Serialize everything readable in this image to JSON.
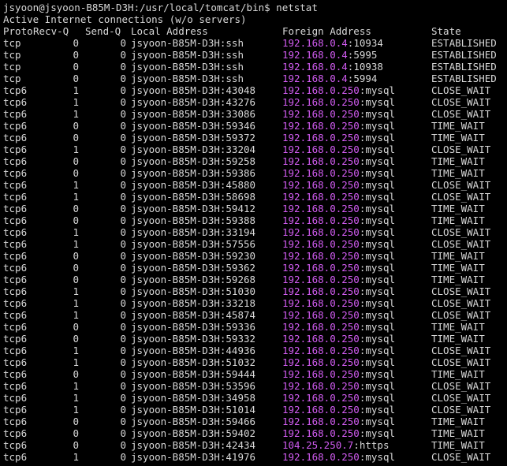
{
  "terminal": {
    "prompt": "jsyoon@jsyoon-B85M-D3H:/usr/local/tomcat/bin$ netstat",
    "title_line": "Active Internet connections (w/o servers)",
    "colors": {
      "background": "#000000",
      "text": "#d8d8d8",
      "ip_highlight": "#d25cf2"
    },
    "headers": {
      "proto": "Proto",
      "recvq": "Recv-Q",
      "sendq": "Send-Q",
      "local": "Local Address",
      "foreign": "Foreign Address",
      "state": "State"
    },
    "rows": [
      {
        "proto": "tcp",
        "recvq": "0",
        "sendq": "0",
        "local": "jsyoon-B85M-D3H:ssh",
        "ip": "192.168.0.4",
        "port": ":10934",
        "state": "ESTABLISHED"
      },
      {
        "proto": "tcp",
        "recvq": "0",
        "sendq": "0",
        "local": "jsyoon-B85M-D3H:ssh",
        "ip": "192.168.0.4",
        "port": ":5995",
        "state": "ESTABLISHED"
      },
      {
        "proto": "tcp",
        "recvq": "0",
        "sendq": "0",
        "local": "jsyoon-B85M-D3H:ssh",
        "ip": "192.168.0.4",
        "port": ":10938",
        "state": "ESTABLISHED"
      },
      {
        "proto": "tcp",
        "recvq": "0",
        "sendq": "0",
        "local": "jsyoon-B85M-D3H:ssh",
        "ip": "192.168.0.4",
        "port": ":5994",
        "state": "ESTABLISHED"
      },
      {
        "proto": "tcp6",
        "recvq": "1",
        "sendq": "0",
        "local": "jsyoon-B85M-D3H:43048",
        "ip": "192.168.0.250",
        "port": ":mysql",
        "state": "CLOSE_WAIT"
      },
      {
        "proto": "tcp6",
        "recvq": "1",
        "sendq": "0",
        "local": "jsyoon-B85M-D3H:43276",
        "ip": "192.168.0.250",
        "port": ":mysql",
        "state": "CLOSE_WAIT"
      },
      {
        "proto": "tcp6",
        "recvq": "1",
        "sendq": "0",
        "local": "jsyoon-B85M-D3H:33086",
        "ip": "192.168.0.250",
        "port": ":mysql",
        "state": "CLOSE_WAIT"
      },
      {
        "proto": "tcp6",
        "recvq": "0",
        "sendq": "0",
        "local": "jsyoon-B85M-D3H:59346",
        "ip": "192.168.0.250",
        "port": ":mysql",
        "state": "TIME_WAIT"
      },
      {
        "proto": "tcp6",
        "recvq": "0",
        "sendq": "0",
        "local": "jsyoon-B85M-D3H:59372",
        "ip": "192.168.0.250",
        "port": ":mysql",
        "state": "TIME_WAIT"
      },
      {
        "proto": "tcp6",
        "recvq": "1",
        "sendq": "0",
        "local": "jsyoon-B85M-D3H:33204",
        "ip": "192.168.0.250",
        "port": ":mysql",
        "state": "CLOSE_WAIT"
      },
      {
        "proto": "tcp6",
        "recvq": "0",
        "sendq": "0",
        "local": "jsyoon-B85M-D3H:59258",
        "ip": "192.168.0.250",
        "port": ":mysql",
        "state": "TIME_WAIT"
      },
      {
        "proto": "tcp6",
        "recvq": "0",
        "sendq": "0",
        "local": "jsyoon-B85M-D3H:59386",
        "ip": "192.168.0.250",
        "port": ":mysql",
        "state": "TIME_WAIT"
      },
      {
        "proto": "tcp6",
        "recvq": "1",
        "sendq": "0",
        "local": "jsyoon-B85M-D3H:45880",
        "ip": "192.168.0.250",
        "port": ":mysql",
        "state": "CLOSE_WAIT"
      },
      {
        "proto": "tcp6",
        "recvq": "1",
        "sendq": "0",
        "local": "jsyoon-B85M-D3H:58698",
        "ip": "192.168.0.250",
        "port": ":mysql",
        "state": "CLOSE_WAIT"
      },
      {
        "proto": "tcp6",
        "recvq": "0",
        "sendq": "0",
        "local": "jsyoon-B85M-D3H:59412",
        "ip": "192.168.0.250",
        "port": ":mysql",
        "state": "TIME_WAIT"
      },
      {
        "proto": "tcp6",
        "recvq": "0",
        "sendq": "0",
        "local": "jsyoon-B85M-D3H:59388",
        "ip": "192.168.0.250",
        "port": ":mysql",
        "state": "TIME_WAIT"
      },
      {
        "proto": "tcp6",
        "recvq": "1",
        "sendq": "0",
        "local": "jsyoon-B85M-D3H:33194",
        "ip": "192.168.0.250",
        "port": ":mysql",
        "state": "CLOSE_WAIT"
      },
      {
        "proto": "tcp6",
        "recvq": "1",
        "sendq": "0",
        "local": "jsyoon-B85M-D3H:57556",
        "ip": "192.168.0.250",
        "port": ":mysql",
        "state": "CLOSE_WAIT"
      },
      {
        "proto": "tcp6",
        "recvq": "0",
        "sendq": "0",
        "local": "jsyoon-B85M-D3H:59230",
        "ip": "192.168.0.250",
        "port": ":mysql",
        "state": "TIME_WAIT"
      },
      {
        "proto": "tcp6",
        "recvq": "0",
        "sendq": "0",
        "local": "jsyoon-B85M-D3H:59362",
        "ip": "192.168.0.250",
        "port": ":mysql",
        "state": "TIME_WAIT"
      },
      {
        "proto": "tcp6",
        "recvq": "0",
        "sendq": "0",
        "local": "jsyoon-B85M-D3H:59268",
        "ip": "192.168.0.250",
        "port": ":mysql",
        "state": "TIME_WAIT"
      },
      {
        "proto": "tcp6",
        "recvq": "1",
        "sendq": "0",
        "local": "jsyoon-B85M-D3H:51030",
        "ip": "192.168.0.250",
        "port": ":mysql",
        "state": "CLOSE_WAIT"
      },
      {
        "proto": "tcp6",
        "recvq": "1",
        "sendq": "0",
        "local": "jsyoon-B85M-D3H:33218",
        "ip": "192.168.0.250",
        "port": ":mysql",
        "state": "CLOSE_WAIT"
      },
      {
        "proto": "tcp6",
        "recvq": "1",
        "sendq": "0",
        "local": "jsyoon-B85M-D3H:45874",
        "ip": "192.168.0.250",
        "port": ":mysql",
        "state": "CLOSE_WAIT"
      },
      {
        "proto": "tcp6",
        "recvq": "0",
        "sendq": "0",
        "local": "jsyoon-B85M-D3H:59336",
        "ip": "192.168.0.250",
        "port": ":mysql",
        "state": "TIME_WAIT"
      },
      {
        "proto": "tcp6",
        "recvq": "0",
        "sendq": "0",
        "local": "jsyoon-B85M-D3H:59332",
        "ip": "192.168.0.250",
        "port": ":mysql",
        "state": "TIME_WAIT"
      },
      {
        "proto": "tcp6",
        "recvq": "1",
        "sendq": "0",
        "local": "jsyoon-B85M-D3H:44936",
        "ip": "192.168.0.250",
        "port": ":mysql",
        "state": "CLOSE_WAIT"
      },
      {
        "proto": "tcp6",
        "recvq": "1",
        "sendq": "0",
        "local": "jsyoon-B85M-D3H:51032",
        "ip": "192.168.0.250",
        "port": ":mysql",
        "state": "CLOSE_WAIT"
      },
      {
        "proto": "tcp6",
        "recvq": "0",
        "sendq": "0",
        "local": "jsyoon-B85M-D3H:59444",
        "ip": "192.168.0.250",
        "port": ":mysql",
        "state": "TIME_WAIT"
      },
      {
        "proto": "tcp6",
        "recvq": "1",
        "sendq": "0",
        "local": "jsyoon-B85M-D3H:53596",
        "ip": "192.168.0.250",
        "port": ":mysql",
        "state": "CLOSE_WAIT"
      },
      {
        "proto": "tcp6",
        "recvq": "1",
        "sendq": "0",
        "local": "jsyoon-B85M-D3H:34958",
        "ip": "192.168.0.250",
        "port": ":mysql",
        "state": "CLOSE_WAIT"
      },
      {
        "proto": "tcp6",
        "recvq": "1",
        "sendq": "0",
        "local": "jsyoon-B85M-D3H:51014",
        "ip": "192.168.0.250",
        "port": ":mysql",
        "state": "CLOSE_WAIT"
      },
      {
        "proto": "tcp6",
        "recvq": "0",
        "sendq": "0",
        "local": "jsyoon-B85M-D3H:59466",
        "ip": "192.168.0.250",
        "port": ":mysql",
        "state": "TIME_WAIT"
      },
      {
        "proto": "tcp6",
        "recvq": "0",
        "sendq": "0",
        "local": "jsyoon-B85M-D3H:59402",
        "ip": "192.168.0.250",
        "port": ":mysql",
        "state": "TIME_WAIT"
      },
      {
        "proto": "tcp6",
        "recvq": "0",
        "sendq": "0",
        "local": "jsyoon-B85M-D3H:42434",
        "ip": "104.25.250.7",
        "port": ":https",
        "state": "TIME_WAIT"
      },
      {
        "proto": "tcp6",
        "recvq": "1",
        "sendq": "0",
        "local": "jsyoon-B85M-D3H:41976",
        "ip": "192.168.0.250",
        "port": ":mysql",
        "state": "CLOSE_WAIT"
      }
    ]
  }
}
